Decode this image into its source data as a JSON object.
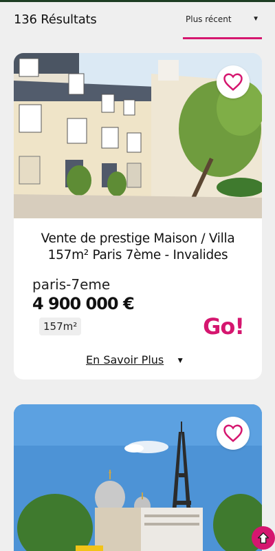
{
  "header": {
    "results_label": "136 Résultats",
    "sort_value": "Plus récent"
  },
  "colors": {
    "accent": "#d5166f",
    "topline": "#1e3d23",
    "background": "#efefef"
  },
  "listings": [
    {
      "title_line1": "Vente de prestige Maison / Villa",
      "title_line2": "157m² Paris 7ème - Invalides",
      "location": "paris-7eme",
      "price": "4 900 000 €",
      "area": "157m²",
      "cta": "Go!",
      "more_label": "En Savoir Plus",
      "favorite_icon": "heart-outline-icon"
    },
    {
      "favorite_icon": "heart-outline-icon"
    }
  ],
  "scroll_top_icon": "arrow-up-icon"
}
